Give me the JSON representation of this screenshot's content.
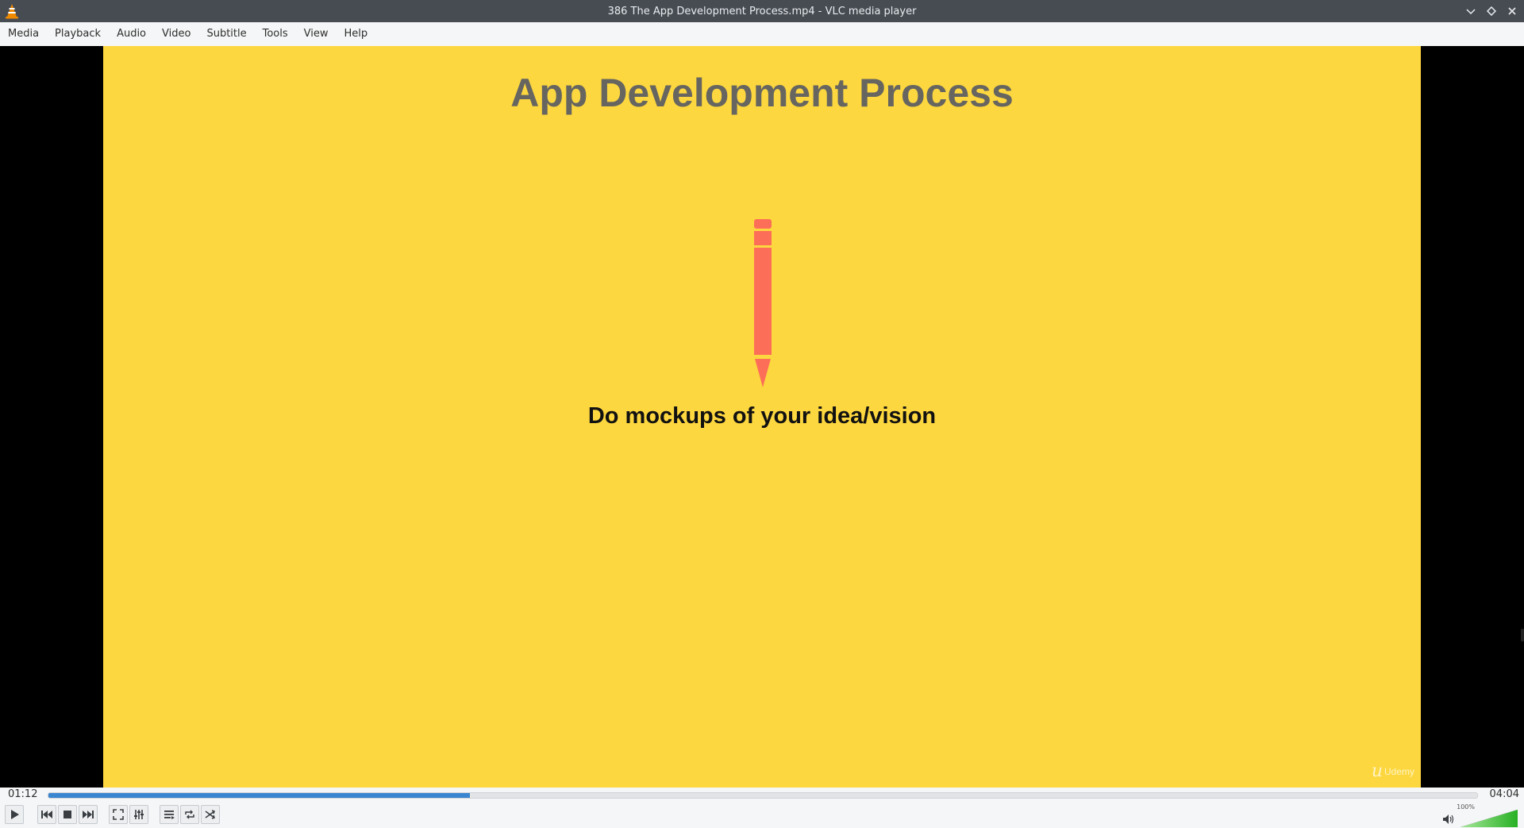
{
  "window": {
    "title": "386 The App Development Process.mp4 - VLC media player",
    "accent_color": "#f08a00"
  },
  "menu": {
    "items": [
      {
        "id": "media",
        "label": "Media"
      },
      {
        "id": "playback",
        "label": "Playback"
      },
      {
        "id": "audio",
        "label": "Audio"
      },
      {
        "id": "video",
        "label": "Video"
      },
      {
        "id": "subtitle",
        "label": "Subtitle"
      },
      {
        "id": "tools",
        "label": "Tools"
      },
      {
        "id": "view",
        "label": "View"
      },
      {
        "id": "help",
        "label": "Help"
      }
    ]
  },
  "video": {
    "slide_title": "App Development Process",
    "slide_subtitle": "Do mockups of your idea/vision",
    "watermark": "Udemy",
    "background_color": "#fdd73f",
    "pencil_color": "#fd6e58",
    "icon": "pencil-icon"
  },
  "seek": {
    "elapsed": "01:12",
    "total": "04:04",
    "progress_fraction": 0.295,
    "fill_color": "#3b86d0"
  },
  "controls": {
    "icons": [
      "play-icon",
      "previous-icon",
      "stop-icon",
      "next-icon",
      "fullscreen-icon",
      "extended-settings-icon",
      "playlist-icon",
      "loop-icon",
      "shuffle-icon"
    ]
  },
  "volume": {
    "percent_label": "100%",
    "level_fraction": 1.0,
    "icon": "speaker-icon"
  }
}
